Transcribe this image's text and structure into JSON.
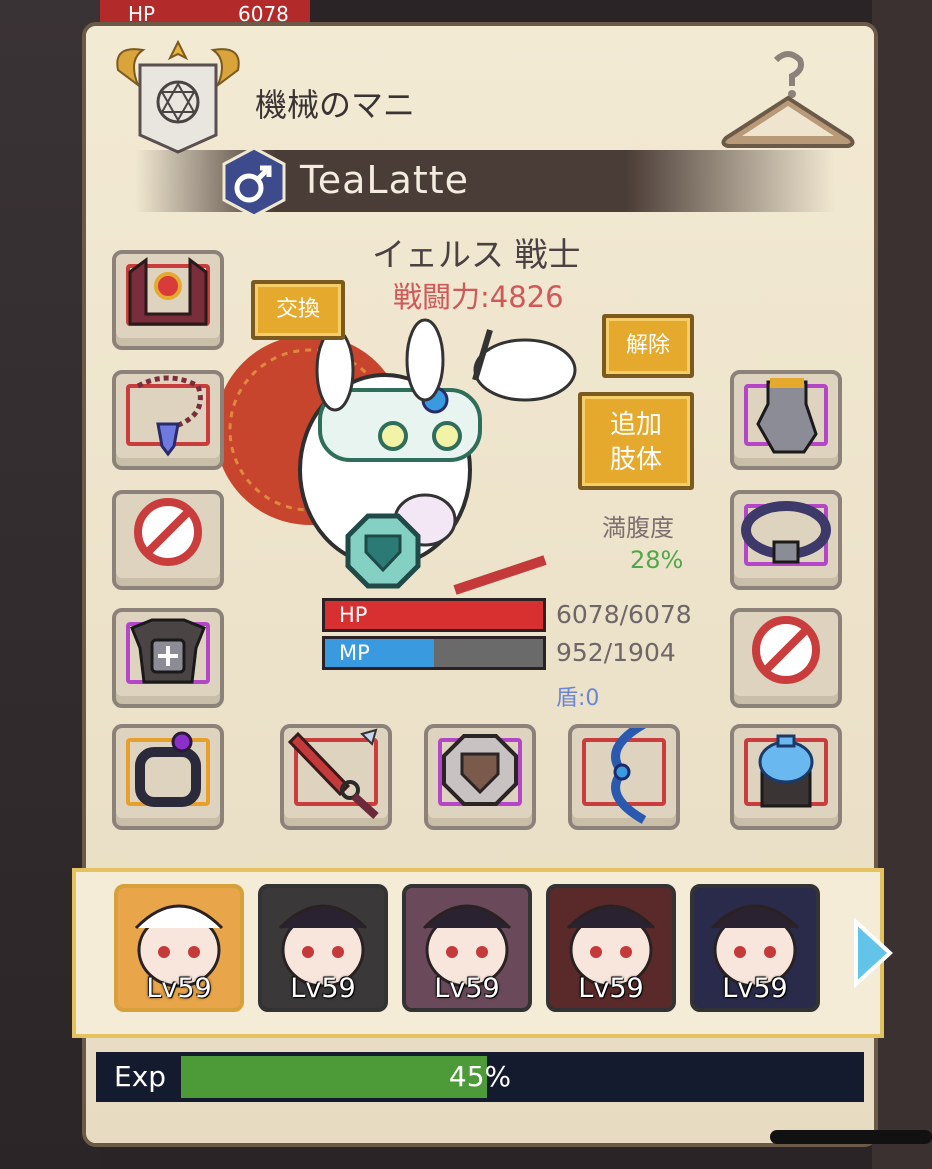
{
  "background": {
    "hp_label": "HP",
    "hp_value": "6078"
  },
  "header": {
    "title": "機械のマニ",
    "player_name": "TeaLatte",
    "gender_symbol": "♂",
    "hanger_icon": "hanger-question-icon",
    "emblem_icon": "guild-emblem-icon"
  },
  "character": {
    "class": "イェルス 戦士",
    "power": "戦闘力:4826"
  },
  "buttons": {
    "exchange": "交換",
    "release": "解除",
    "add_limb_line1": "追加",
    "add_limb_line2": "肢体"
  },
  "stats": {
    "hunger_label": "満腹度",
    "hunger_value": "28%",
    "hp_label": "HP",
    "hp_value": "6078/6078",
    "hp_fraction": 1.0,
    "mp_label": "MP",
    "mp_value": "952/1904",
    "mp_fraction": 0.5,
    "shield": "盾:0"
  },
  "equipment": {
    "left": [
      "helmet-icon",
      "necklace-icon",
      "empty-slot-icon",
      "armor-icon",
      "ring-icon"
    ],
    "right": [
      "gauntlet-icon",
      "belt-icon",
      "empty-slot-icon",
      "potion-icon"
    ],
    "bottom": [
      "sword-icon",
      "shield-icon",
      "bow-icon"
    ]
  },
  "party": {
    "members": [
      {
        "level": "Lv59"
      },
      {
        "level": "Lv59"
      },
      {
        "level": "Lv59"
      },
      {
        "level": "Lv59"
      },
      {
        "level": "Lv59"
      }
    ]
  },
  "exp": {
    "label": "Exp",
    "percent": "45%",
    "fraction": 0.45
  },
  "colors": {
    "gold_button": "#e5a92d",
    "hp": "#d83030",
    "mp": "#3a9ae0",
    "exp": "#4c9a38",
    "power_text": "#d05858",
    "hunger_text": "#4fa84a"
  }
}
